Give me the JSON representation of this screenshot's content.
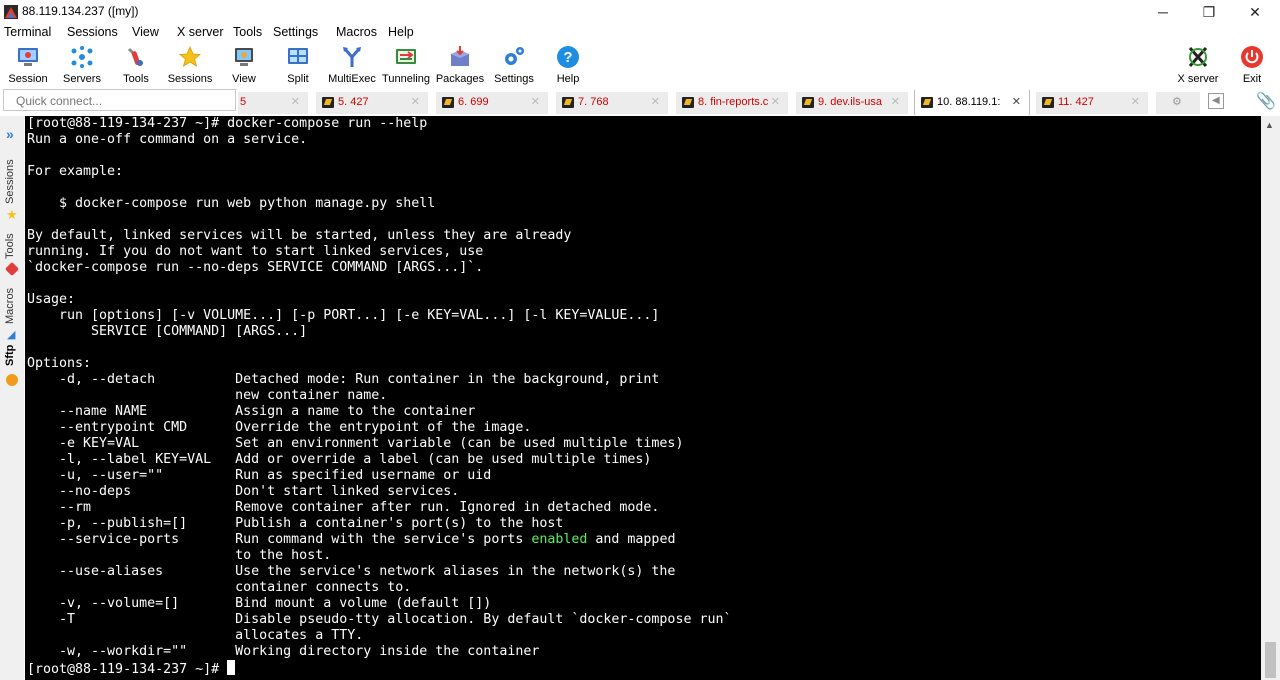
{
  "window": {
    "title": "88.119.134.237 ([my])",
    "minimize": "─",
    "maximize": "❐",
    "close": "✕"
  },
  "menu": [
    "Terminal",
    "Sessions",
    "View",
    "X server",
    "Tools",
    "Settings",
    "Macros",
    "Help"
  ],
  "toolbar": {
    "items": [
      {
        "label": "Session",
        "icon": "session-icon"
      },
      {
        "label": "Servers",
        "icon": "servers-icon"
      },
      {
        "label": "Tools",
        "icon": "tools-icon"
      },
      {
        "label": "Sessions",
        "icon": "star-icon"
      },
      {
        "label": "View",
        "icon": "view-icon"
      },
      {
        "label": "Split",
        "icon": "split-icon"
      },
      {
        "label": "MultiExec",
        "icon": "multiexec-icon"
      },
      {
        "label": "Tunneling",
        "icon": "tunneling-icon"
      },
      {
        "label": "Packages",
        "icon": "packages-icon"
      },
      {
        "label": "Settings",
        "icon": "gear-icon"
      },
      {
        "label": "Help",
        "icon": "help-icon"
      }
    ],
    "xserver_label": "X server",
    "exit_label": "Exit"
  },
  "quick_connect": {
    "placeholder": "Quick connect..."
  },
  "tabs": [
    {
      "label": "5",
      "active": false
    },
    {
      "label": "5. 427",
      "active": false
    },
    {
      "label": "6. 699",
      "active": false
    },
    {
      "label": "7. 768",
      "active": false
    },
    {
      "label": "8. fin-reports.c",
      "active": false
    },
    {
      "label": "9. dev.ils-usa",
      "active": false
    },
    {
      "label": "10. 88.119.1:",
      "active": true
    },
    {
      "label": "11. 427",
      "active": false
    }
  ],
  "side_panel": {
    "sessions": "Sessions",
    "tools": "Tools",
    "macros": "Macros",
    "sftp": "Sftp"
  },
  "terminal": {
    "lines": [
      "[root@88-119-134-237 ~]# docker-compose run --help",
      "Run a one-off command on a service.",
      "",
      "For example:",
      "",
      "    $ docker-compose run web python manage.py shell",
      "",
      "By default, linked services will be started, unless they are already",
      "running. If you do not want to start linked services, use",
      "`docker-compose run --no-deps SERVICE COMMAND [ARGS...]`.",
      "",
      "Usage:",
      "    run [options] [-v VOLUME...] [-p PORT...] [-e KEY=VAL...] [-l KEY=VALUE...]",
      "        SERVICE [COMMAND] [ARGS...]",
      "",
      "Options:",
      "    -d, --detach          Detached mode: Run container in the background, print",
      "                          new container name.",
      "    --name NAME           Assign a name to the container",
      "    --entrypoint CMD      Override the entrypoint of the image.",
      "    -e KEY=VAL            Set an environment variable (can be used multiple times)",
      "    -l, --label KEY=VAL   Add or override a label (can be used multiple times)",
      "    -u, --user=\"\"         Run as specified username or uid",
      "    --no-deps             Don't start linked services.",
      "    --rm                  Remove container after run. Ignored in detached mode.",
      "    -p, --publish=[]      Publish a container's port(s) to the host",
      "    --service-ports       Run command with the service's ports |enabled| and mapped",
      "                          to the host.",
      "    --use-aliases         Use the service's network aliases in the network(s) the",
      "                          container connects to.",
      "    -v, --volume=[]       Bind mount a volume (default [])",
      "    -T                    Disable pseudo-tty allocation. By default `docker-compose run`",
      "                          allocates a TTY.",
      "    -w, --workdir=\"\"      Working directory inside the container"
    ],
    "prompt": "[root@88-119-134-237 ~]# ",
    "highlight_color": "#5af05a"
  },
  "colors": {
    "terminal_bg": "#000000",
    "terminal_fg": "#ffffff",
    "tab_text": "#d00000"
  }
}
